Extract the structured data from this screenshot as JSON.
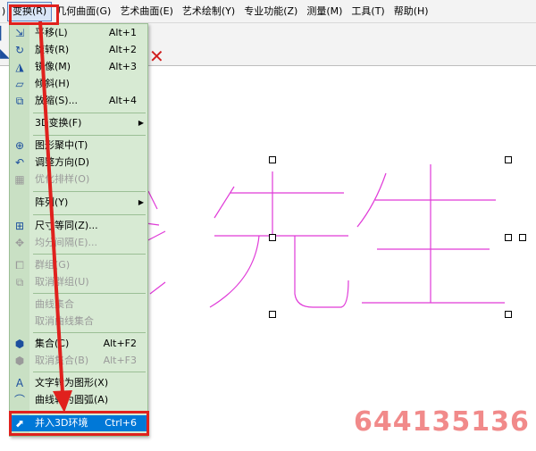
{
  "menubar": {
    "left_edge": ")",
    "items": [
      {
        "label": "变换(R)",
        "active": true
      },
      {
        "label": "几何曲面(G)"
      },
      {
        "label": "艺术曲面(E)"
      },
      {
        "label": "艺术绘制(Y)"
      },
      {
        "label": "专业功能(Z)"
      },
      {
        "label": "测量(M)"
      },
      {
        "label": "工具(T)"
      },
      {
        "label": "帮助(H)"
      }
    ]
  },
  "dropdown": {
    "items": [
      {
        "label": "平移(L)",
        "shortcut": "Alt+1",
        "icon": "move-icon"
      },
      {
        "label": "旋转(R)",
        "shortcut": "Alt+2",
        "icon": "rotate-icon"
      },
      {
        "label": "镜像(M)",
        "shortcut": "Alt+3",
        "icon": "mirror-icon"
      },
      {
        "label": "倾斜(H)",
        "shortcut": "",
        "icon": "skew-icon"
      },
      {
        "label": "放缩(S)...",
        "shortcut": "Alt+4",
        "icon": "scale-icon"
      },
      {
        "label": "3D变换(F)",
        "shortcut": "",
        "icon": "",
        "submenu": true
      },
      {
        "label": "图形聚中(T)",
        "shortcut": "",
        "icon": "center-icon"
      },
      {
        "label": "调整方向(D)",
        "shortcut": "",
        "icon": "direction-icon"
      },
      {
        "label": "优化排样(O)",
        "shortcut": "",
        "icon": "nesting-icon",
        "disabled": true
      },
      {
        "label": "阵列(Y)",
        "shortcut": "",
        "icon": "",
        "submenu": true
      },
      {
        "label": "尺寸等同(Z)...",
        "shortcut": "",
        "icon": "size-equal-icon"
      },
      {
        "label": "均分间隔(E)...",
        "shortcut": "",
        "icon": "distribute-icon",
        "disabled": true
      },
      {
        "label": "群组(G)",
        "shortcut": "",
        "icon": "group-icon",
        "disabled": true
      },
      {
        "label": "取消群组(U)",
        "shortcut": "",
        "icon": "ungroup-icon",
        "disabled": true
      },
      {
        "label": "曲线集合",
        "shortcut": "",
        "icon": "",
        "disabled": true
      },
      {
        "label": "取消曲线集合",
        "shortcut": "",
        "icon": "",
        "disabled": true
      },
      {
        "label": "集合(C)",
        "shortcut": "Alt+F2",
        "icon": "combine-icon"
      },
      {
        "label": "取消集合(B)",
        "shortcut": "Alt+F3",
        "icon": "uncombine-icon",
        "disabled": true
      },
      {
        "label": "文字转为图形(X)",
        "shortcut": "",
        "icon": "text-to-shape-icon"
      },
      {
        "label": "曲线转为圆弧(A)",
        "shortcut": "",
        "icon": "curve-to-arc-icon"
      },
      {
        "label": "并入3D环境",
        "shortcut": "Ctrl+6",
        "icon": "merge-3d-icon",
        "highlight": true
      }
    ]
  },
  "canvas": {
    "glyphs_color": "#e03ad8"
  },
  "watermark": {
    "text": "644135136"
  },
  "colors": {
    "annotation": "#e0211d",
    "menu_bg": "#d7ead3",
    "highlight": "#0078d7"
  }
}
